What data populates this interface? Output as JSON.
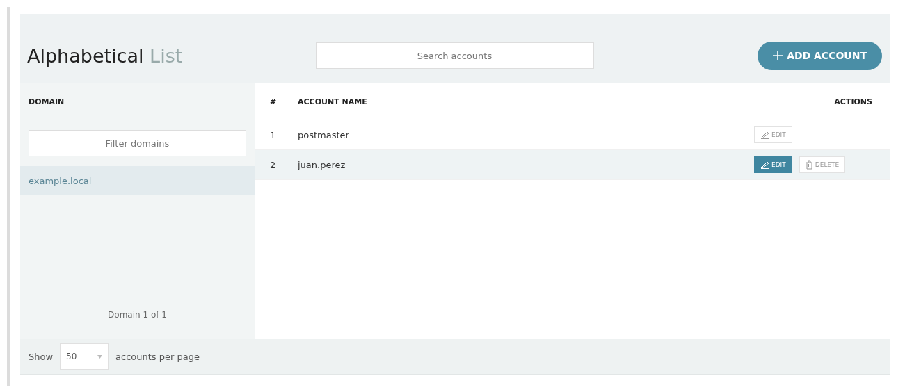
{
  "title": {
    "bold": "Alphabetical",
    "light": "List"
  },
  "search": {
    "placeholder": "Search accounts"
  },
  "add_button": {
    "label": "ADD ACCOUNT"
  },
  "sidebar": {
    "heading": "DOMAIN",
    "filter": {
      "placeholder": "Filter domains"
    },
    "items": [
      {
        "label": "example.local",
        "selected": true
      }
    ],
    "pager": "Domain 1 of 1"
  },
  "table": {
    "columns": [
      "#",
      "ACCOUNT NAME",
      "ACTIONS"
    ],
    "rows": [
      {
        "index": "1",
        "name": "postmaster",
        "hovered": false,
        "actions": [
          {
            "kind": "edit",
            "label": "EDIT",
            "active": false
          }
        ]
      },
      {
        "index": "2",
        "name": "juan.perez",
        "hovered": true,
        "actions": [
          {
            "kind": "edit",
            "label": "EDIT",
            "active": true
          },
          {
            "kind": "delete",
            "label": "DELETE",
            "active": false
          }
        ]
      }
    ]
  },
  "footer": {
    "show": "Show",
    "page_size": "50",
    "suffix": "accounts per page"
  }
}
